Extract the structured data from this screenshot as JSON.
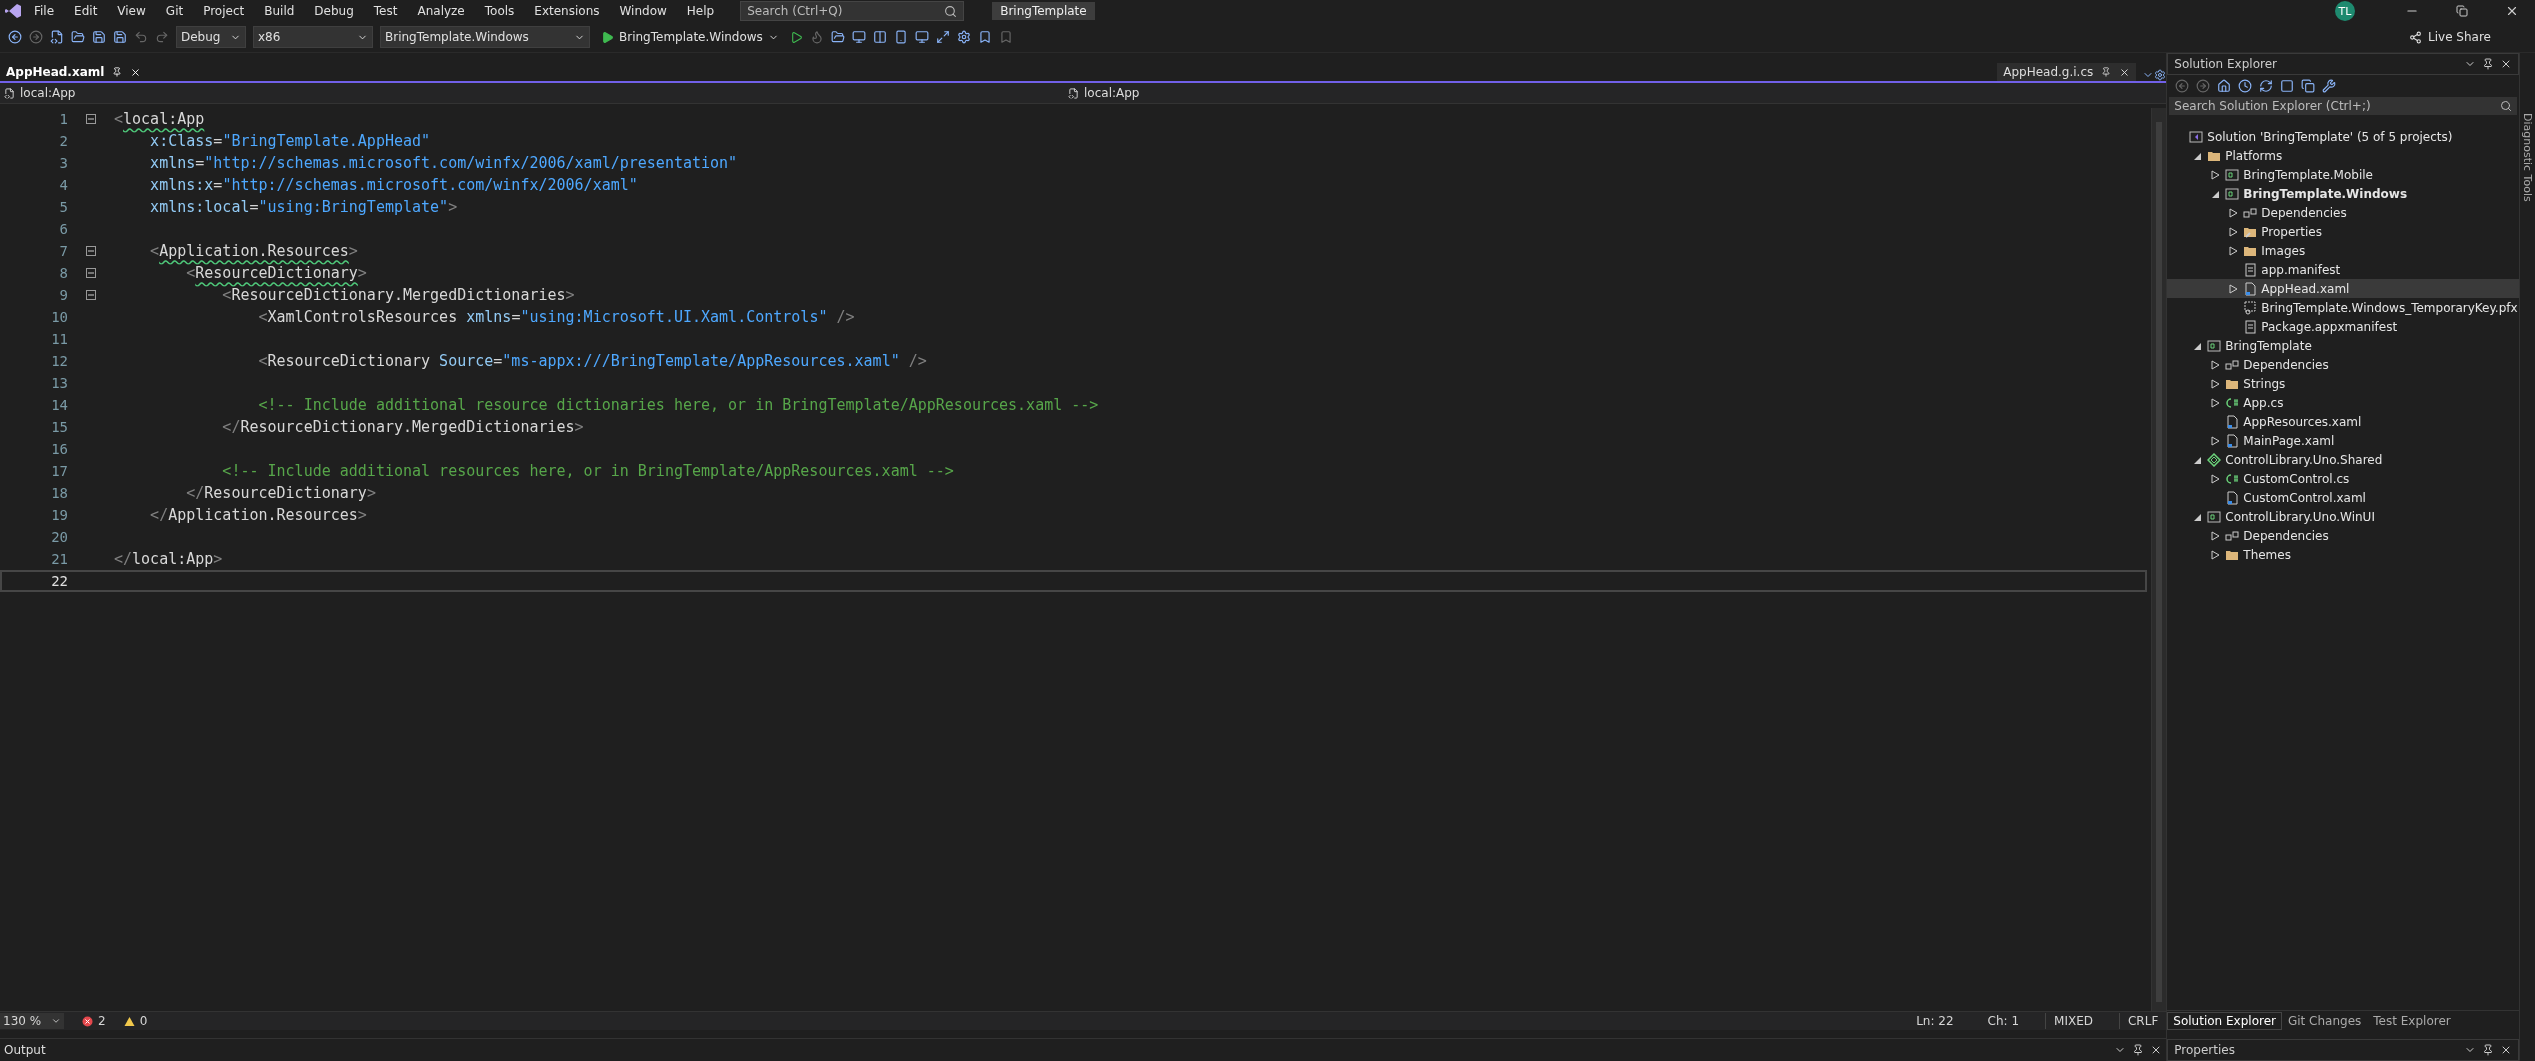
{
  "menu": {
    "items": [
      "File",
      "Edit",
      "View",
      "Git",
      "Project",
      "Build",
      "Debug",
      "Test",
      "Analyze",
      "Tools",
      "Extensions",
      "Window",
      "Help"
    ],
    "search": {
      "placeholder": "Search (Ctrl+Q)"
    },
    "title": "BringTemplate",
    "avatar": "TL"
  },
  "toolbar": {
    "configuration": "Debug",
    "platform": "x86",
    "startup": "BringTemplate.Windows",
    "run": "BringTemplate.Windows",
    "live_share": "Live Share"
  },
  "tabs": [
    {
      "label": "AppHead.xaml",
      "selected": true
    }
  ],
  "preview_tab": {
    "label": "AppHead.g.i.cs"
  },
  "nav": {
    "left": "local:App",
    "right": "local:App"
  },
  "code": [
    {
      "number": "1",
      "fold": true,
      "current": false,
      "tokens": [
        {
          "text": "<",
          "kind": "bracket",
          "squiggle": false
        },
        {
          "text": "local:App",
          "kind": "element",
          "squiggle": true
        }
      ]
    },
    {
      "number": "2",
      "fold": false,
      "current": false,
      "tokens": [
        {
          "text": "    x:Class",
          "kind": "attr",
          "squiggle": false
        },
        {
          "text": "=",
          "kind": "eq",
          "squiggle": false
        },
        {
          "text": "\"BringTemplate.AppHead\"",
          "kind": "value",
          "squiggle": false
        }
      ]
    },
    {
      "number": "3",
      "fold": false,
      "current": false,
      "tokens": [
        {
          "text": "    xmlns",
          "kind": "attr",
          "squiggle": false
        },
        {
          "text": "=",
          "kind": "eq",
          "squiggle": false
        },
        {
          "text": "\"http://schemas.microsoft.com/winfx/2006/xaml/presentation\"",
          "kind": "value",
          "squiggle": false
        }
      ]
    },
    {
      "number": "4",
      "fold": false,
      "current": false,
      "tokens": [
        {
          "text": "    xmlns:x",
          "kind": "attr",
          "squiggle": false
        },
        {
          "text": "=",
          "kind": "eq",
          "squiggle": false
        },
        {
          "text": "\"http://schemas.microsoft.com/winfx/2006/xaml\"",
          "kind": "value",
          "squiggle": false
        }
      ]
    },
    {
      "number": "5",
      "fold": false,
      "current": false,
      "tokens": [
        {
          "text": "    xmlns:local",
          "kind": "attr",
          "squiggle": false
        },
        {
          "text": "=",
          "kind": "eq",
          "squiggle": false
        },
        {
          "text": "\"using:BringTemplate\"",
          "kind": "value",
          "squiggle": false
        },
        {
          "text": ">",
          "kind": "bracket",
          "squiggle": false
        }
      ]
    },
    {
      "number": "6",
      "fold": false,
      "current": false
    },
    {
      "number": "7",
      "fold": true,
      "current": false,
      "tokens": [
        {
          "text": "    <",
          "kind": "bracket",
          "squiggle": false
        },
        {
          "text": "Application.Resources",
          "kind": "element",
          "squiggle": true
        },
        {
          "text": ">",
          "kind": "bracket",
          "squiggle": false
        }
      ]
    },
    {
      "number": "8",
      "fold": true,
      "current": false,
      "tokens": [
        {
          "text": "        <",
          "kind": "bracket",
          "squiggle": false
        },
        {
          "text": "ResourceDictionary",
          "kind": "element",
          "squiggle": true
        },
        {
          "text": ">",
          "kind": "bracket",
          "squiggle": false
        }
      ]
    },
    {
      "number": "9",
      "fold": true,
      "current": false,
      "tokens": [
        {
          "text": "            <",
          "kind": "bracket",
          "squiggle": false
        },
        {
          "text": "ResourceDictionary.MergedDictionaries",
          "kind": "element",
          "squiggle": false
        },
        {
          "text": ">",
          "kind": "bracket",
          "squiggle": false
        }
      ]
    },
    {
      "number": "10",
      "fold": false,
      "current": false,
      "tokens": [
        {
          "text": "                <",
          "kind": "bracket",
          "squiggle": false
        },
        {
          "text": "XamlControlsResources",
          "kind": "element",
          "squiggle": false
        },
        {
          "text": " xmlns",
          "kind": "attr",
          "squiggle": false
        },
        {
          "text": "=",
          "kind": "eq",
          "squiggle": false
        },
        {
          "text": "\"using:Microsoft.UI.Xaml.Controls\"",
          "kind": "value",
          "squiggle": false
        },
        {
          "text": " />",
          "kind": "bracket",
          "squiggle": false
        }
      ]
    },
    {
      "number": "11",
      "fold": false,
      "current": false
    },
    {
      "number": "12",
      "fold": false,
      "current": false,
      "tokens": [
        {
          "text": "                <",
          "kind": "bracket",
          "squiggle": false
        },
        {
          "text": "ResourceDictionary",
          "kind": "element",
          "squiggle": false
        },
        {
          "text": " Source",
          "kind": "attr",
          "squiggle": false
        },
        {
          "text": "=",
          "kind": "eq",
          "squiggle": false
        },
        {
          "text": "\"ms-appx:///BringTemplate/AppResources.xaml\"",
          "kind": "value",
          "squiggle": false
        },
        {
          "text": " />",
          "kind": "bracket",
          "squiggle": false
        }
      ]
    },
    {
      "number": "13",
      "fold": false,
      "current": false
    },
    {
      "number": "14",
      "fold": false,
      "current": false,
      "tokens": [
        {
          "text": "                <!-- Include additional resource dictionaries here, or in BringTemplate/AppResources.xaml -->",
          "kind": "comment",
          "squiggle": false
        }
      ]
    },
    {
      "number": "15",
      "fold": false,
      "current": false,
      "tokens": [
        {
          "text": "            </",
          "kind": "bracket",
          "squiggle": false
        },
        {
          "text": "ResourceDictionary.MergedDictionaries",
          "kind": "element",
          "squiggle": false
        },
        {
          "text": ">",
          "kind": "bracket",
          "squiggle": false
        }
      ]
    },
    {
      "number": "16",
      "fold": false,
      "current": false
    },
    {
      "number": "17",
      "fold": false,
      "current": false,
      "tokens": [
        {
          "text": "            <!-- Include additional resources here, or in BringTemplate/AppResources.xaml -->",
          "kind": "comment",
          "squiggle": false
        }
      ]
    },
    {
      "number": "18",
      "fold": false,
      "current": false,
      "tokens": [
        {
          "text": "        </",
          "kind": "bracket",
          "squiggle": false
        },
        {
          "text": "ResourceDictionary",
          "kind": "element",
          "squiggle": false
        },
        {
          "text": ">",
          "kind": "bracket",
          "squiggle": false
        }
      ]
    },
    {
      "number": "19",
      "fold": false,
      "current": false,
      "tokens": [
        {
          "text": "    </",
          "kind": "bracket",
          "squiggle": false
        },
        {
          "text": "Application.Resources",
          "kind": "element",
          "squiggle": false
        },
        {
          "text": ">",
          "kind": "bracket",
          "squiggle": false
        }
      ]
    },
    {
      "number": "20",
      "fold": false,
      "current": false
    },
    {
      "number": "21",
      "fold": false,
      "current": false,
      "tokens": [
        {
          "text": "</",
          "kind": "bracket",
          "squiggle": false
        },
        {
          "text": "local:App",
          "kind": "element",
          "squiggle": false
        },
        {
          "text": ">",
          "kind": "bracket",
          "squiggle": false
        }
      ]
    },
    {
      "number": "22",
      "fold": false,
      "current": true
    }
  ],
  "status_bar": {
    "zoom": "130 %",
    "errors": "2",
    "warnings": "0",
    "line": "Ln: 22",
    "column": "Ch: 1",
    "indentation": "MIXED",
    "line_endings": "CRLF"
  },
  "output": {
    "title": "Output"
  },
  "solution_explorer": {
    "title": "Solution Explorer",
    "search": {
      "placeholder": "Search Solution Explorer (Ctrl+;)"
    },
    "tree": [
      {
        "label": "Solution 'BringTemplate' (5 of 5 projects)",
        "kind": "solution",
        "selected": false,
        "startup": false,
        "children": [
          {
            "label": "Platforms",
            "kind": "folder",
            "expanded": true,
            "selected": false,
            "startup": false,
            "children": [
              {
                "label": "BringTemplate.Mobile",
                "kind": "project",
                "expanded": false,
                "selected": false,
                "startup": false
              },
              {
                "label": "BringTemplate.Windows",
                "kind": "project",
                "expanded": true,
                "selected": false,
                "startup": true,
                "children": [
                  {
                    "label": "Dependencies",
                    "kind": "dependencies",
                    "expanded": false,
                    "selected": false,
                    "startup": false
                  },
                  {
                    "label": "Properties",
                    "kind": "properties",
                    "expanded": false,
                    "selected": false,
                    "startup": false
                  },
                  {
                    "label": "Images",
                    "kind": "folder",
                    "expanded": false,
                    "selected": false,
                    "startup": false
                  },
                  {
                    "label": "app.manifest",
                    "kind": "manifest",
                    "selected": false,
                    "startup": false
                  },
                  {
                    "label": "AppHead.xaml",
                    "kind": "xaml",
                    "expanded": false,
                    "selected": true,
                    "startup": false
                  },
                  {
                    "label": "BringTemplate.Windows_TemporaryKey.pfx",
                    "kind": "certificate",
                    "selected": false,
                    "startup": false
                  },
                  {
                    "label": "Package.appxmanifest",
                    "kind": "manifest",
                    "selected": false,
                    "startup": false
                  }
                ]
              }
            ]
          },
          {
            "label": "BringTemplate",
            "kind": "project",
            "expanded": true,
            "selected": false,
            "startup": false,
            "children": [
              {
                "label": "Dependencies",
                "kind": "dependencies",
                "expanded": false,
                "selected": false,
                "startup": false
              },
              {
                "label": "Strings",
                "kind": "folder",
                "expanded": false,
                "selected": false,
                "startup": false
              },
              {
                "label": "App.cs",
                "kind": "csharp",
                "expanded": false,
                "selected": false,
                "startup": false
              },
              {
                "label": "AppResources.xaml",
                "kind": "xaml",
                "selected": false,
                "startup": false
              },
              {
                "label": "MainPage.xaml",
                "kind": "xaml",
                "expanded": false,
                "selected": false,
                "startup": false
              }
            ]
          },
          {
            "label": "ControlLibrary.Uno.Shared",
            "kind": "shared",
            "expanded": true,
            "selected": false,
            "startup": false,
            "children": [
              {
                "label": "CustomControl.cs",
                "kind": "csharp",
                "expanded": false,
                "selected": false,
                "startup": false
              },
              {
                "label": "CustomControl.xaml",
                "kind": "xaml",
                "selected": false,
                "startup": false
              }
            ]
          },
          {
            "label": "ControlLibrary.Uno.WinUI",
            "kind": "project",
            "expanded": true,
            "selected": false,
            "startup": false,
            "children": [
              {
                "label": "Dependencies",
                "kind": "dependencies",
                "expanded": false,
                "selected": false,
                "startup": false
              },
              {
                "label": "Themes",
                "kind": "folder",
                "expanded": false,
                "selected": false,
                "startup": false
              }
            ]
          }
        ]
      }
    ]
  },
  "bottom_tabs": [
    {
      "label": "Solution Explorer",
      "selected": true
    },
    {
      "label": "Git Changes",
      "selected": false
    },
    {
      "label": "Test Explorer",
      "selected": false
    }
  ],
  "properties": {
    "title": "Properties"
  },
  "side_strip": {
    "label": "Diagnostic Tools"
  }
}
